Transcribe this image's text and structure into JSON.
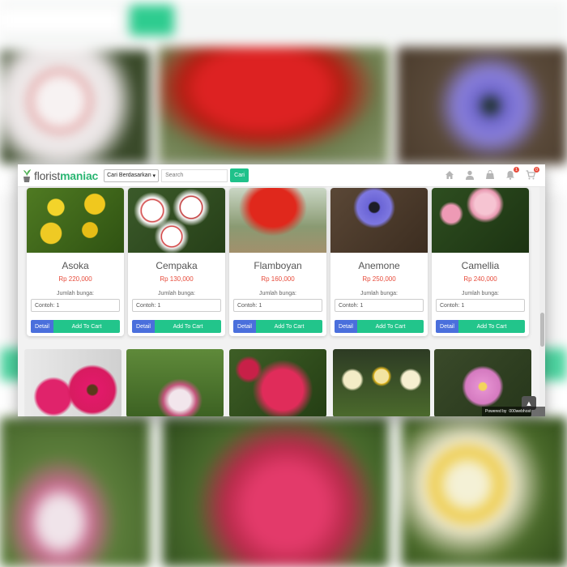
{
  "header": {
    "logo_text_plain": "florist",
    "logo_text_accent": "maniac",
    "category_select": "Cari Berdasarkan",
    "search_placeholder": "Search",
    "search_button": "Cari",
    "cart_badge": "1",
    "orders_badge": "0"
  },
  "products": [
    {
      "name": "Asoka",
      "price": "Rp 220,000",
      "qty_label": "Jumlah bunga:",
      "qty_placeholder": "Contoh: 1",
      "detail": "Detail",
      "add": "Add To Cart"
    },
    {
      "name": "Cempaka",
      "price": "Rp 130,000",
      "qty_label": "Jumlah bunga:",
      "qty_placeholder": "Contoh: 1",
      "detail": "Detail",
      "add": "Add To Cart"
    },
    {
      "name": "Flamboyan",
      "price": "Rp 160,000",
      "qty_label": "Jumlah bunga:",
      "qty_placeholder": "Contoh: 1",
      "detail": "Detail",
      "add": "Add To Cart"
    },
    {
      "name": "Anemone",
      "price": "Rp 250,000",
      "qty_label": "Jumlah bunga:",
      "qty_placeholder": "Contoh: 1",
      "detail": "Detail",
      "add": "Add To Cart"
    },
    {
      "name": "Camellia",
      "price": "Rp 240,000",
      "qty_label": "Jumlah bunga:",
      "qty_placeholder": "Contoh: 1",
      "detail": "Detail",
      "add": "Add To Cart"
    }
  ],
  "footer": {
    "powered_by": "Powered by",
    "host": "000webhost",
    "back_to_top": "▲"
  },
  "colors": {
    "accent": "#1fc18a",
    "detail": "#4a6fdc",
    "price": "#e74c3c"
  },
  "icons": [
    "home-icon",
    "user-icon",
    "bag-icon",
    "bell-icon",
    "cart-icon",
    "chevron-up-icon",
    "flower-pot-icon"
  ]
}
